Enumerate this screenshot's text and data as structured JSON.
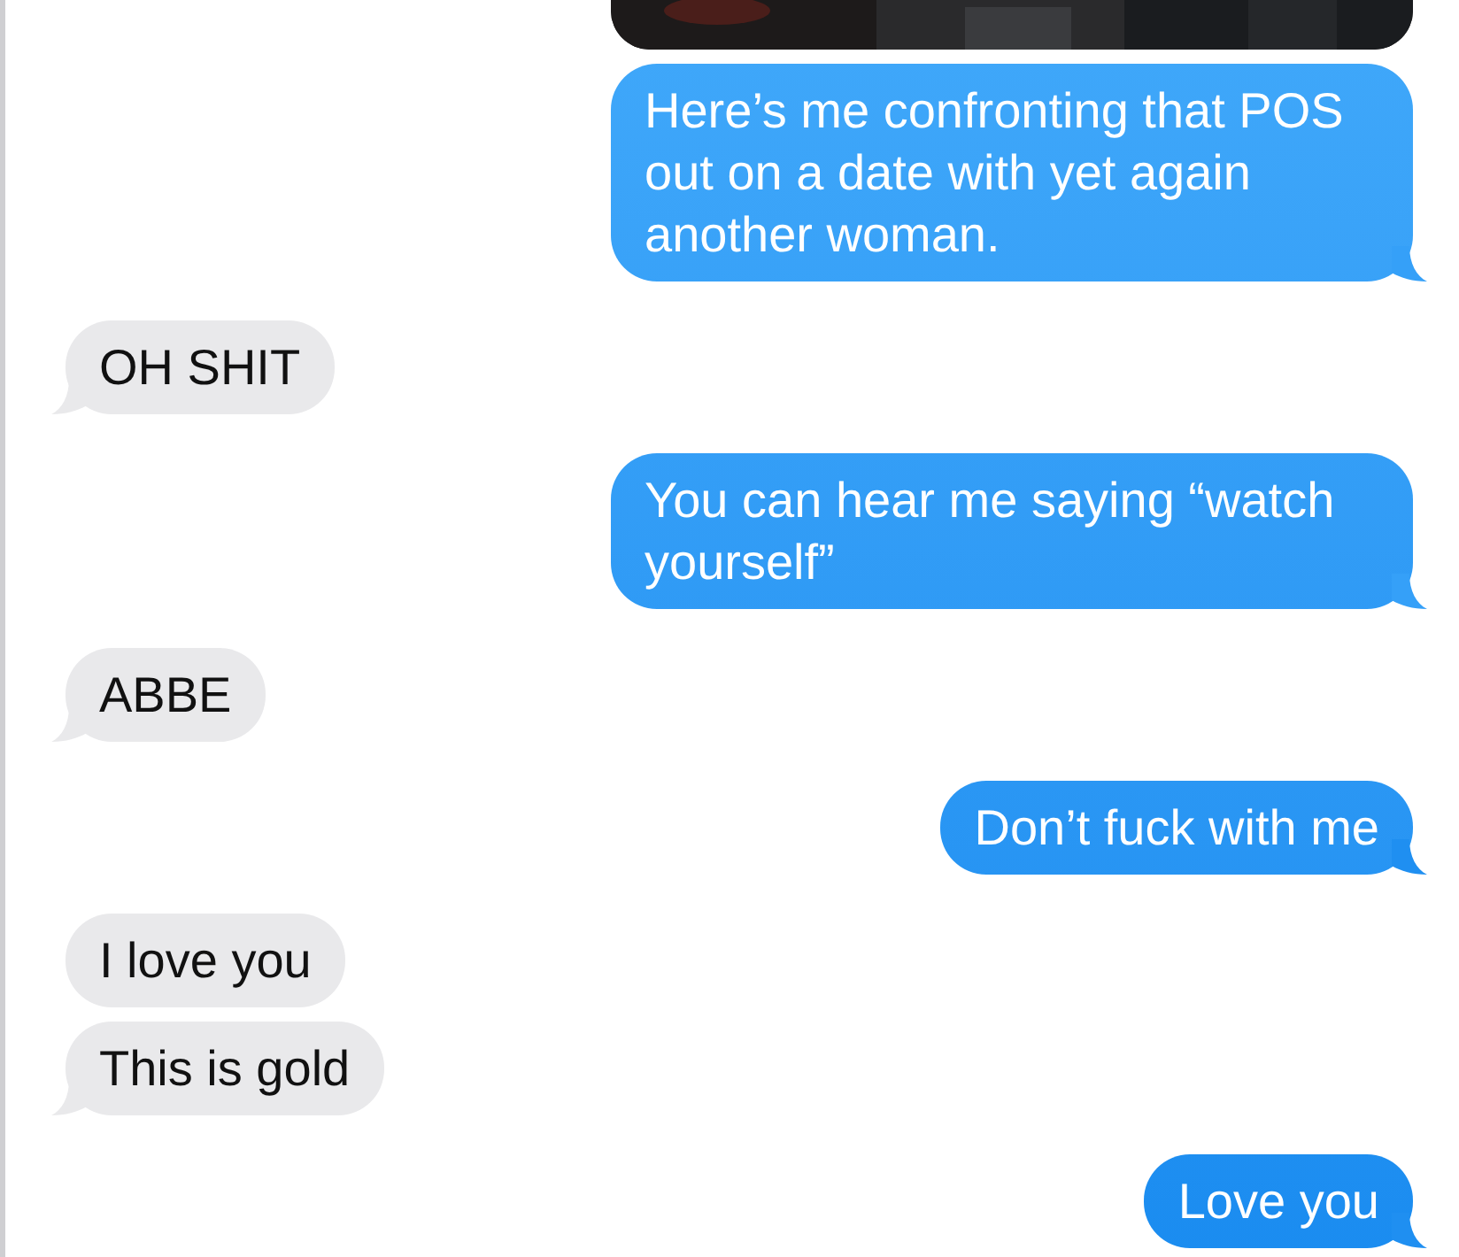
{
  "messages": [
    {
      "kind": "picture",
      "from_me": true
    },
    {
      "kind": "text",
      "from_me": true,
      "tail": true,
      "text": "Here’s me confronting that POS out on a date with yet again another woman."
    },
    {
      "kind": "text",
      "from_me": false,
      "tail": true,
      "text": "OH SHIT"
    },
    {
      "kind": "text",
      "from_me": true,
      "tail": true,
      "text": "You can hear me saying “watch yourself”"
    },
    {
      "kind": "text",
      "from_me": false,
      "tail": true,
      "text": "ABBE"
    },
    {
      "kind": "text",
      "from_me": true,
      "tail": true,
      "text": "Don’t fuck with me"
    },
    {
      "kind": "text",
      "from_me": false,
      "tail": false,
      "text": "I love you"
    },
    {
      "kind": "text",
      "from_me": false,
      "tail": true,
      "text": "This is gold"
    },
    {
      "kind": "text",
      "from_me": true,
      "tail": true,
      "text": "Love you"
    }
  ]
}
